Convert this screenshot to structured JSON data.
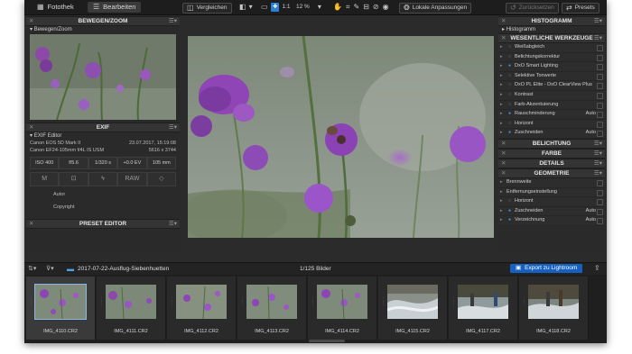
{
  "topbar": {
    "tab_library": "Fotothek",
    "tab_edit": "Bearbeiten",
    "compare": "Vergleichen",
    "zoom_ratio": "1:1",
    "zoom_percent": "12 %",
    "local_adjust": "Lokale Anpassungen",
    "undo": "Zurücksetzen",
    "presets": "Presets"
  },
  "left": {
    "zoom_title": "BEWEGEN/ZOOM",
    "zoom_sub": "Bewegen/Zoom",
    "exif_title": "EXIF",
    "exif_sub": "EXIF Editor",
    "camera": "Canon EOS 5D Mark II",
    "date": "23.07.2017, 15:19:08",
    "lens": "Canon EF24-105mm f/4L IS USM",
    "resolution": "5616 x 3744",
    "iso": "ISO 400",
    "aperture": "f/5.6",
    "shutter": "1/320 s",
    "ev": "+0.0 EV",
    "focal": "105 mm",
    "mode": "M",
    "raw": "RAW",
    "author_label": "Autor",
    "copyright_label": "Copyright",
    "preset_title": "PRESET EDITOR"
  },
  "right": {
    "histogram_title": "HISTOGRAMM",
    "histogram_sub": "Histogramm",
    "tools_title": "WESENTLICHE WERKZEUGE",
    "tools": [
      {
        "label": "Weißabgleich",
        "value": ""
      },
      {
        "label": "Belichtungskorrektur",
        "value": ""
      },
      {
        "label": "DxO Smart Lighting",
        "value": ""
      },
      {
        "label": "Selektive Tonwerte",
        "value": ""
      },
      {
        "label": "DxO PL Elite - DxO ClearView Plus",
        "value": ""
      },
      {
        "label": "Kontrast",
        "value": ""
      },
      {
        "label": "Farb-Akzentuierung",
        "value": ""
      },
      {
        "label": "Rauschminderung",
        "value": "Auto"
      },
      {
        "label": "Horizont",
        "value": ""
      },
      {
        "label": "Zuschneiden",
        "value": "Auto"
      }
    ],
    "light_title": "BELICHTUNG",
    "color_title": "FARBE",
    "detail_title": "DETAILS",
    "geometry_title": "GEOMETRIE",
    "geometry": [
      {
        "label": "Brennweite",
        "value": ""
      },
      {
        "label": "Entfernungseinstellung",
        "value": ""
      },
      {
        "label": "Horizont",
        "value": ""
      },
      {
        "label": "Zuschneiden",
        "value": "Auto"
      },
      {
        "label": "Verzeichnung",
        "value": "Auto"
      }
    ]
  },
  "filmstrip": {
    "folder": "2017-07-22-Ausflug-Siebenhuetten",
    "count": "1/125 Bilder",
    "export": "Export zu Lightroom",
    "images": [
      "IMG_4110.CR2",
      "IMG_4111.CR2",
      "IMG_4112.CR2",
      "IMG_4113.CR2",
      "IMG_4114.CR2",
      "IMG_4115.CR2",
      "IMG_4117.CR2",
      "IMG_4118.CR2"
    ]
  },
  "colors": {
    "accent": "#2b7fd8",
    "bg": "#2b2b2b"
  }
}
